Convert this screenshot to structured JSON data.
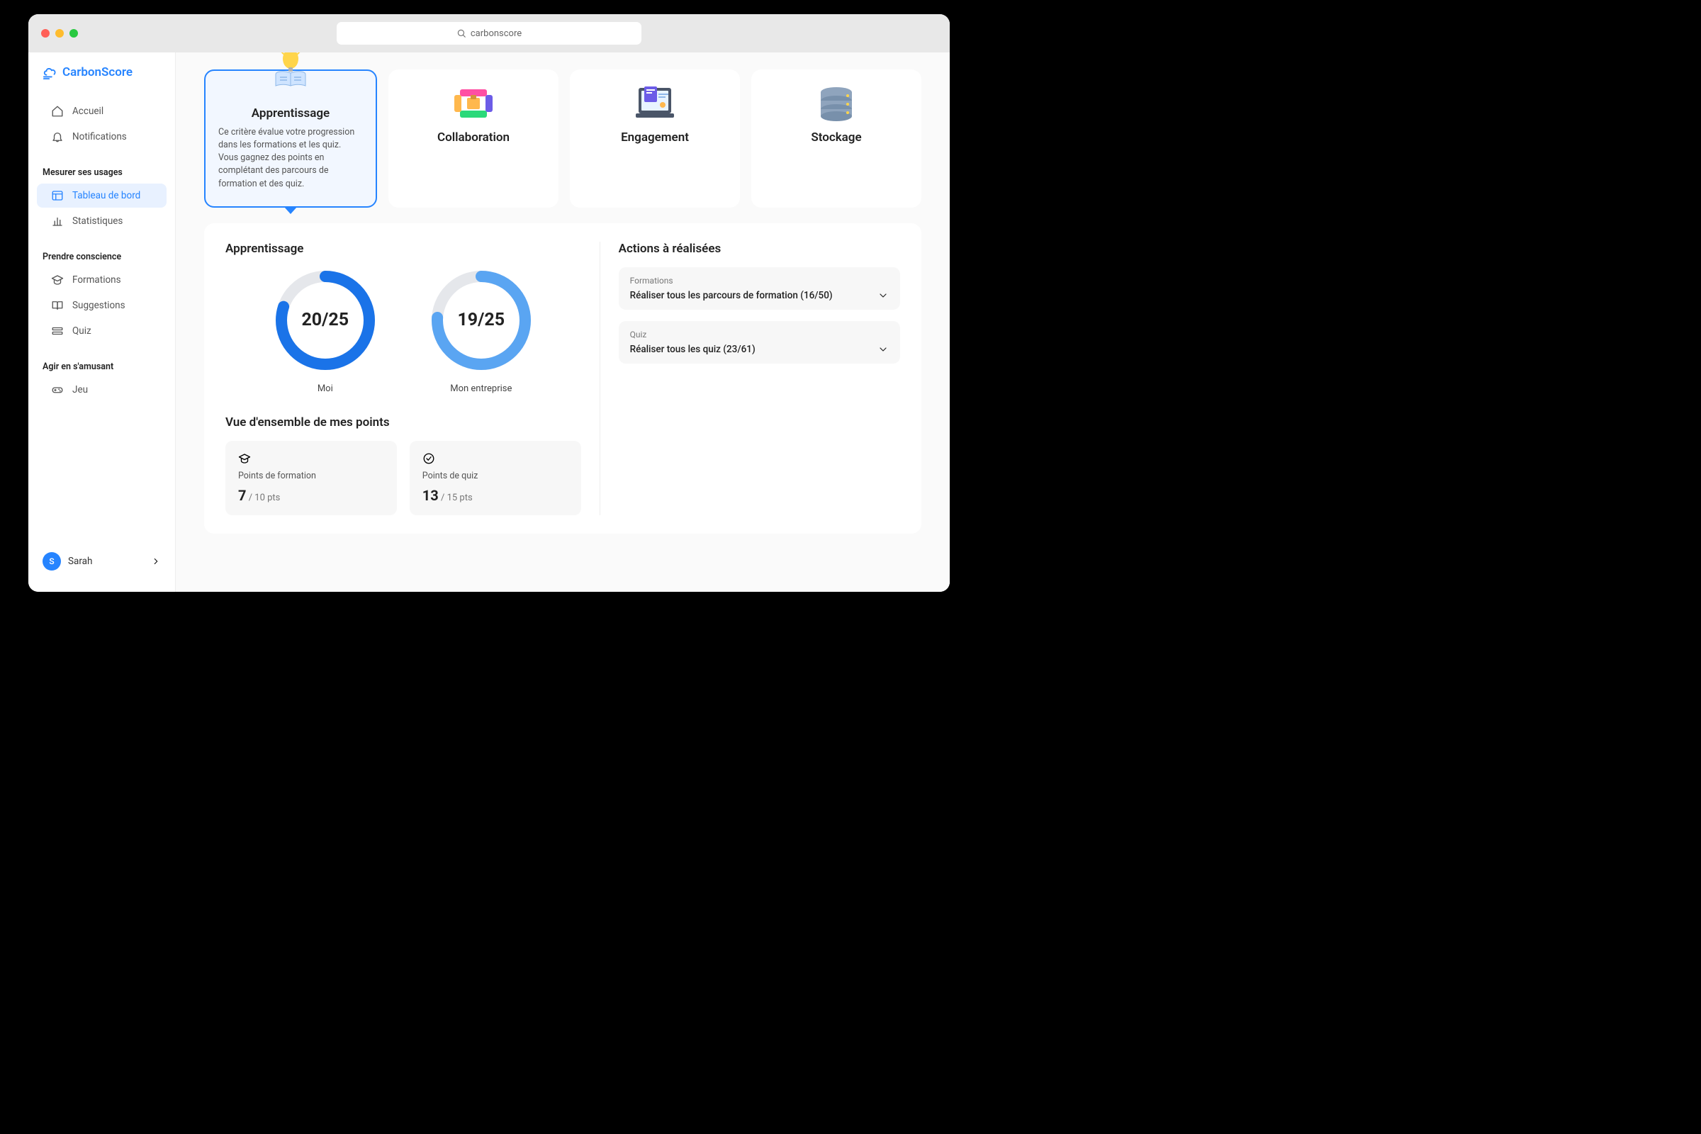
{
  "search": {
    "placeholder": "carbonscore"
  },
  "brand": {
    "name": "CarbonScore"
  },
  "sidebar": {
    "top": [
      {
        "label": "Accueil",
        "icon": "home"
      },
      {
        "label": "Notifications",
        "icon": "bell"
      }
    ],
    "sections": [
      {
        "heading": "Mesurer ses usages",
        "items": [
          {
            "label": "Tableau de bord",
            "icon": "dashboard",
            "active": true
          },
          {
            "label": "Statistiques",
            "icon": "stats"
          }
        ]
      },
      {
        "heading": "Prendre conscience",
        "items": [
          {
            "label": "Formations",
            "icon": "grad"
          },
          {
            "label": "Suggestions",
            "icon": "book"
          },
          {
            "label": "Quiz",
            "icon": "quiz"
          }
        ]
      },
      {
        "heading": "Agir en s'amusant",
        "items": [
          {
            "label": "Jeu",
            "icon": "game"
          }
        ]
      }
    ],
    "user": {
      "initial": "S",
      "name": "Sarah"
    }
  },
  "tabs": [
    {
      "title": "Apprentissage",
      "desc": "Ce critère évalue votre progression dans les formations et les quiz. Vous gagnez des points en complétant des parcours de formation et des quiz.",
      "active": true
    },
    {
      "title": "Collaboration"
    },
    {
      "title": "Engagement"
    },
    {
      "title": "Stockage"
    }
  ],
  "panel": {
    "title": "Apprentissage",
    "gauges": [
      {
        "value": 20,
        "max": 25,
        "text": "20/25",
        "label": "Moi",
        "color": "#1a73e8"
      },
      {
        "value": 19,
        "max": 25,
        "text": "19/25",
        "label": "Mon entreprise",
        "color": "#5aa5f2"
      }
    ],
    "points_title": "Vue d'ensemble de mes points",
    "points": [
      {
        "label": "Points de formation",
        "value": "7",
        "suffix": " / 10 pts",
        "icon": "grad"
      },
      {
        "label": "Points de quiz",
        "value": "13",
        "suffix": " / 15 pts",
        "icon": "check"
      }
    ],
    "actions_title": "Actions à réalisées",
    "actions": [
      {
        "tag": "Formations",
        "text": "Réaliser tous les parcours de formation (16/50)"
      },
      {
        "tag": "Quiz",
        "text": "Réaliser tous les quiz (23/61)"
      }
    ]
  }
}
